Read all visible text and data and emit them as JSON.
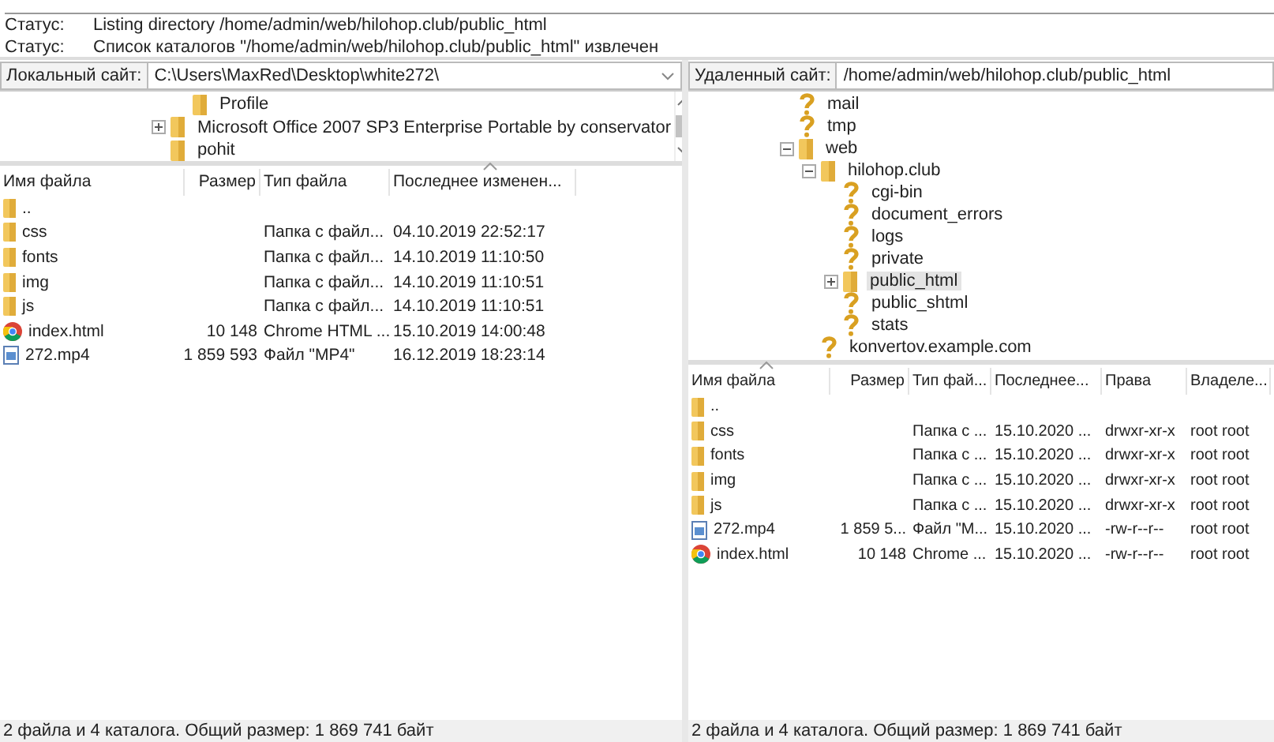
{
  "log": [
    {
      "label": "Статус:",
      "text": "Listing directory /home/admin/web/hilohop.club/public_html"
    },
    {
      "label": "Статус:",
      "text": "Список каталогов \"/home/admin/web/hilohop.club/public_html\" извлечен"
    }
  ],
  "local": {
    "site_label": "Локальный сайт:",
    "path": "C:\\Users\\MaxRed\\Desktop\\white272\\",
    "tree": [
      {
        "children": [
          {
            "label": "Profile",
            "kind": "folder"
          }
        ]
      },
      {
        "label": "Microsoft Office 2007 SP3 Enterprise Portable by conservator",
        "kind": "folder",
        "expanded": false
      },
      {
        "label": "pohit",
        "kind": "folder"
      }
    ],
    "columns": [
      {
        "label": "Имя файла",
        "sorted": false
      },
      {
        "label": "Размер",
        "sorted": false
      },
      {
        "label": "Тип файла",
        "sorted": false
      },
      {
        "label": "Последнее изменен...",
        "sorted": true
      }
    ],
    "files": [
      {
        "kind": "folder",
        "cells": [
          "..",
          "",
          "",
          ""
        ]
      },
      {
        "kind": "folder",
        "cells": [
          "css",
          "",
          "Папка с файл...",
          "04.10.2019 22:52:17"
        ]
      },
      {
        "kind": "folder",
        "cells": [
          "fonts",
          "",
          "Папка с файл...",
          "14.10.2019 11:10:50"
        ]
      },
      {
        "kind": "folder",
        "cells": [
          "img",
          "",
          "Папка с файл...",
          "14.10.2019 11:10:51"
        ]
      },
      {
        "kind": "folder",
        "cells": [
          "js",
          "",
          "Папка с файл...",
          "14.10.2019 11:10:51"
        ]
      },
      {
        "kind": "web",
        "cells": [
          "index.html",
          "10 148",
          "Chrome HTML ...",
          "15.10.2019 14:00:48"
        ]
      },
      {
        "kind": "video",
        "cells": [
          "272.mp4",
          "1 859 593",
          "Файл \"MP4\"",
          "16.12.2019 18:23:14"
        ]
      }
    ],
    "status": "2 файла и 4 каталога. Общий размер: 1 869 741 байт"
  },
  "remote": {
    "site_label": "Удаленный сайт:",
    "path": "/home/admin/web/hilohop.club/public_html",
    "tree": [
      {
        "children": [
          {
            "label": "mail",
            "kind": "unknown"
          },
          {
            "label": "tmp",
            "kind": "unknown"
          },
          {
            "label": "web",
            "kind": "folder",
            "expanded": true,
            "children": [
              {
                "label": "hilohop.club",
                "kind": "folder",
                "expanded": true,
                "children": [
                  {
                    "label": "cgi-bin",
                    "kind": "unknown"
                  },
                  {
                    "label": "document_errors",
                    "kind": "unknown"
                  },
                  {
                    "label": "logs",
                    "kind": "unknown"
                  },
                  {
                    "label": "private",
                    "kind": "unknown"
                  },
                  {
                    "label": "public_html",
                    "kind": "folder",
                    "expanded": false,
                    "selected": true
                  },
                  {
                    "label": "public_shtml",
                    "kind": "unknown"
                  },
                  {
                    "label": "stats",
                    "kind": "unknown"
                  }
                ]
              },
              {
                "label": "konvertov.example.com",
                "kind": "unknown"
              }
            ]
          }
        ]
      }
    ],
    "columns": [
      {
        "label": "Имя файла",
        "sorted": true
      },
      {
        "label": "Размер",
        "sorted": false
      },
      {
        "label": "Тип фай...",
        "sorted": false
      },
      {
        "label": "Последнее...",
        "sorted": false
      },
      {
        "label": "Права",
        "sorted": false
      },
      {
        "label": "Владеле...",
        "sorted": false
      }
    ],
    "files": [
      {
        "kind": "folder",
        "cells": [
          "..",
          "",
          "",
          "",
          "",
          ""
        ]
      },
      {
        "kind": "folder",
        "cells": [
          "css",
          "",
          "Папка с ...",
          "15.10.2020 ...",
          "drwxr-xr-x",
          "root root"
        ]
      },
      {
        "kind": "folder",
        "cells": [
          "fonts",
          "",
          "Папка с ...",
          "15.10.2020 ...",
          "drwxr-xr-x",
          "root root"
        ]
      },
      {
        "kind": "folder",
        "cells": [
          "img",
          "",
          "Папка с ...",
          "15.10.2020 ...",
          "drwxr-xr-x",
          "root root"
        ]
      },
      {
        "kind": "folder",
        "cells": [
          "js",
          "",
          "Папка с ...",
          "15.10.2020 ...",
          "drwxr-xr-x",
          "root root"
        ]
      },
      {
        "kind": "video",
        "cells": [
          "272.mp4",
          "1 859 5...",
          "Файл \"M...",
          "15.10.2020 ...",
          "-rw-r--r--",
          "root root"
        ]
      },
      {
        "kind": "web",
        "cells": [
          "index.html",
          "10 148",
          "Chrome ...",
          "15.10.2020 ...",
          "-rw-r--r--",
          "root root"
        ]
      }
    ],
    "status": "2 файла и 4 каталога. Общий размер: 1 869 741 байт"
  }
}
